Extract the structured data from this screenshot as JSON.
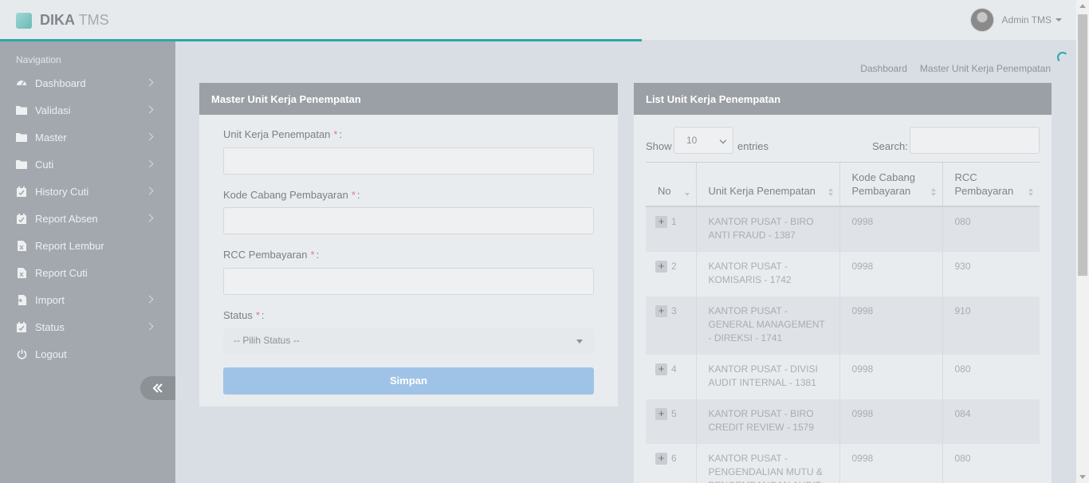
{
  "header": {
    "brand_bold": "DIKA",
    "brand_light": "TMS",
    "user_name": "Admin TMS"
  },
  "sidebar": {
    "title": "Navigation",
    "items": [
      {
        "label": "Dashboard",
        "icon": "dashboard-icon",
        "chevron": true
      },
      {
        "label": "Validasi",
        "icon": "folder-icon",
        "chevron": true
      },
      {
        "label": "Master",
        "icon": "folder-icon",
        "chevron": true
      },
      {
        "label": "Cuti",
        "icon": "folder-icon",
        "chevron": true
      },
      {
        "label": "History Cuti",
        "icon": "calendar-icon",
        "chevron": true
      },
      {
        "label": "Report Absen",
        "icon": "calendar-icon",
        "chevron": true
      },
      {
        "label": "Report Lembur",
        "icon": "excel-file-icon",
        "chevron": false
      },
      {
        "label": "Report Cuti",
        "icon": "excel-file-icon",
        "chevron": false
      },
      {
        "label": "Import",
        "icon": "import-file-icon",
        "chevron": true
      },
      {
        "label": "Status",
        "icon": "calendar-icon",
        "chevron": true
      },
      {
        "label": "Logout",
        "icon": "power-icon",
        "chevron": false
      }
    ]
  },
  "breadcrumb": [
    "Dashboard",
    "Master Unit Kerja Penempatan"
  ],
  "form": {
    "title": "Master Unit Kerja Penempatan",
    "fields": [
      {
        "label": "Unit Kerja Penempatan",
        "value": ""
      },
      {
        "label": "Kode Cabang Pembayaran",
        "value": ""
      },
      {
        "label": "RCC Pembayaran",
        "value": ""
      }
    ],
    "status_label": "Status",
    "status_value": "-- Pilih Status --",
    "required_mark": "*",
    "colon": ":",
    "save_label": "Simpan"
  },
  "list": {
    "title": "List Unit Kerja Penempatan",
    "show_label": "Show",
    "page_length": "10",
    "entries_label": "entries",
    "search_label": "Search:",
    "search_value": "",
    "columns": [
      "No",
      "Unit Kerja Penempatan",
      "Kode Cabang Pembayaran",
      "RCC Pembayaran"
    ],
    "rows": [
      {
        "no": "1",
        "unit": "KANTOR PUSAT - BIRO ANTI FRAUD - 1387",
        "kode": "0998",
        "rcc": "080"
      },
      {
        "no": "2",
        "unit": "KANTOR PUSAT - KOMISARIS - 1742",
        "kode": "0998",
        "rcc": "930"
      },
      {
        "no": "3",
        "unit": "KANTOR PUSAT - GENERAL MANAGEMENT - DIREKSI - 1741",
        "kode": "0998",
        "rcc": "910"
      },
      {
        "no": "4",
        "unit": "KANTOR PUSAT - DIVISI AUDIT INTERNAL - 1381",
        "kode": "0998",
        "rcc": "080"
      },
      {
        "no": "5",
        "unit": "KANTOR PUSAT - BIRO CREDIT REVIEW - 1579",
        "kode": "0998",
        "rcc": "084"
      },
      {
        "no": "6",
        "unit": "KANTOR PUSAT - PENGENDALIAN MUTU & PENGEMBANGAN AUDIT",
        "kode": "0998",
        "rcc": "080"
      }
    ]
  },
  "colors": {
    "accent": "#2aa8a8",
    "sidebar": "#a3a8ae",
    "panel_header": "#9ba0a6",
    "save_button": "#9fc3e6",
    "required": "#e07a7a"
  }
}
